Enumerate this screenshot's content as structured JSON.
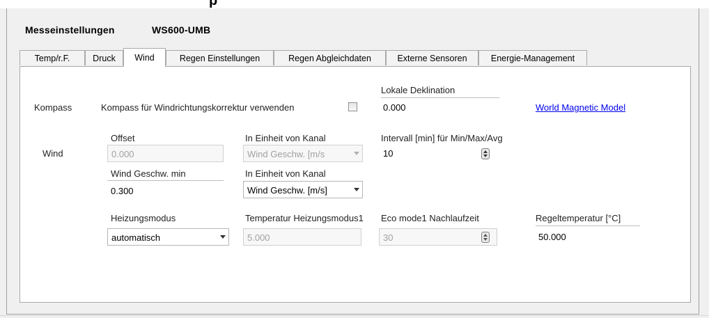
{
  "header_fragment": "p",
  "dialog": {
    "title": "Messeinstellungen",
    "device": "WS600-UMB"
  },
  "tabs": [
    {
      "label": "Temp/r.F."
    },
    {
      "label": "Druck"
    },
    {
      "label": "Wind"
    },
    {
      "label": "Regen Einstellungen"
    },
    {
      "label": "Regen Abgleichdaten"
    },
    {
      "label": "Externe Sensoren"
    },
    {
      "label": "Energie-Management"
    }
  ],
  "active_tab": "Wind",
  "kompass": {
    "section_label": "Kompass",
    "checkbox_label": "Kompass für Windrichtungskorrektur verwenden",
    "checked": false,
    "declination_label": "Lokale Deklination",
    "declination_value": "0.000",
    "link_text": "World Magnetic Model"
  },
  "wind": {
    "section_label": "Wind",
    "offset_label": "Offset",
    "offset_value": "0.000",
    "offset_unit_label": "In Einheit von Kanal",
    "offset_unit_value": "Wind Geschw. [m/s",
    "interval_label": "Intervall [min] für Min/Max/Avg",
    "interval_value": "10",
    "speed_min_label": "Wind Geschw. min",
    "speed_min_value": "0.300",
    "speed_min_unit_label": "In Einheit von Kanal",
    "speed_min_unit_value": "Wind Geschw. [m/s]"
  },
  "heating": {
    "mode_label": "Heizungsmodus",
    "mode_value": "automatisch",
    "temp_label": "Temperatur Heizungsmodus1",
    "temp_value": "5.000",
    "eco_label": "Eco mode1 Nachlaufzeit",
    "eco_value": "30",
    "reg_label": "Regeltemperatur [°C]",
    "reg_value": "50.000"
  },
  "colors": {
    "link": "#0000ee",
    "panel": "#ffffff",
    "background": "#f0f0f0"
  }
}
